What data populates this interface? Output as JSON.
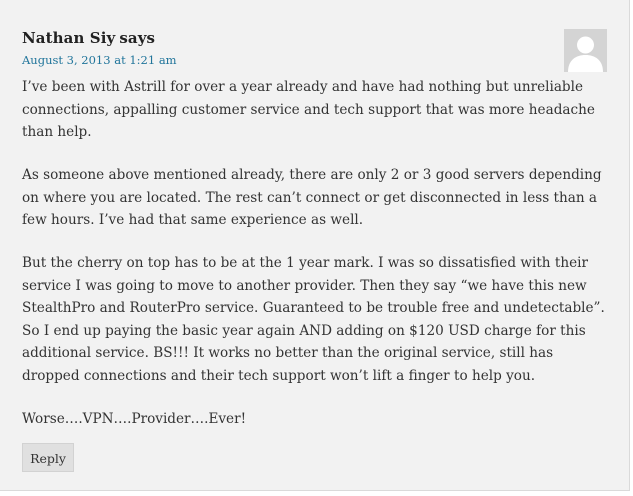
{
  "comment": {
    "author": "Nathan Siy",
    "says": "says",
    "date": "August 3, 2013 at 1:21 am",
    "paragraphs": [
      "I’ve been with Astrill for over a year already and have had nothing but unreliable connections, appalling customer service and tech support that was more headache than help.",
      "As someone above mentioned already, there are only 2 or 3 good servers depending on where you are located. The rest can’t connect or get disconnected in less than a few hours. I’ve had that same experience as well.",
      "But the cherry on top has to be at the 1 year mark. I was so dissatisfied with their service I was going to move to another provider. Then they say “we have this new StealthPro and RouterPro service. Guaranteed to be trouble free and undetectable”. So I end up paying the basic year again AND adding on $120 USD charge for this additional service. BS!!! It works no better than the original service, still has dropped connections and their tech support won’t lift a finger to help you.",
      "Worse….VPN….Provider….Ever!"
    ],
    "reply_label": "Reply",
    "avatar_icon": "default-user-avatar-icon"
  },
  "colors": {
    "background": "#f2f2f2",
    "link": "#21759b",
    "text": "#333333",
    "button": "#e0e0e0"
  }
}
